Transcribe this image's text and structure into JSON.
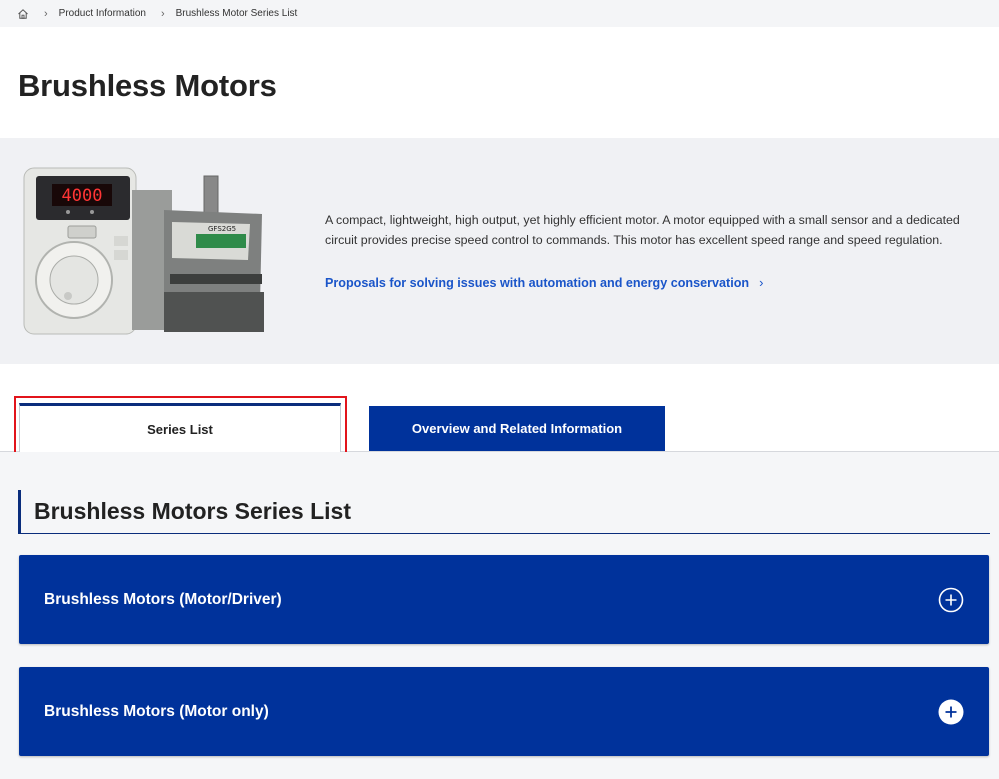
{
  "breadcrumb": {
    "items": [
      "Product Information",
      "Brushless Motor Series List"
    ]
  },
  "page": {
    "title": "Brushless Motors"
  },
  "hero": {
    "description": "A compact, lightweight, high output, yet highly efficient motor. A motor equipped with a small sensor and a dedicated circuit provides precise speed control to commands. This motor has excellent speed range and speed regulation.",
    "link_text": "Proposals for solving issues with automation and energy conservation",
    "image_display": "4000",
    "image_label": "GFS2G5"
  },
  "tabs": [
    {
      "label": "Series List",
      "active": true
    },
    {
      "label": "Overview and Related Information",
      "active": false
    }
  ],
  "section": {
    "title": "Brushless Motors Series List",
    "accordions": [
      {
        "label": "Brushless Motors (Motor/Driver)",
        "expanded": false
      },
      {
        "label": "Brushless Motors (Motor only)",
        "expanded": false
      }
    ]
  },
  "colors": {
    "brand_blue": "#00329b",
    "link_blue": "#1a55c9",
    "highlight_red": "#e2141b"
  }
}
